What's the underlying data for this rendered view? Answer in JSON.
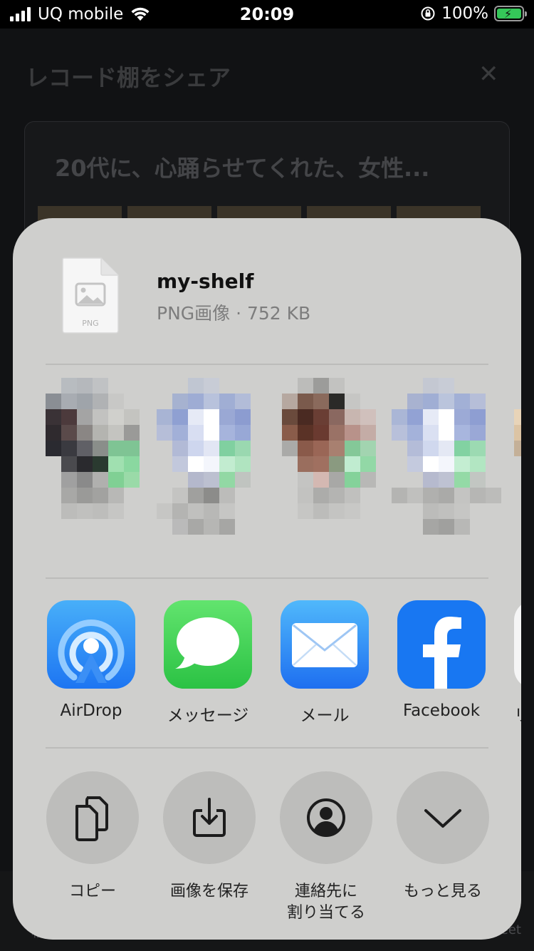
{
  "status_bar": {
    "carrier": "UQ mobile",
    "time": "20:09",
    "battery": "100%"
  },
  "background": {
    "title": "レコード棚をシェア",
    "card_title": "20代に、心踊らせてくれた、女性...",
    "footer_right": "weet",
    "footer_left": "杉"
  },
  "share": {
    "file_name": "my-shelf",
    "file_meta": "PNG画像 · 752 KB",
    "file_type": "PNG",
    "apps": [
      {
        "label": "AirDrop",
        "icon": "airdrop-icon"
      },
      {
        "label": "メッセージ",
        "icon": "messages-icon"
      },
      {
        "label": "メール",
        "icon": "mail-icon"
      },
      {
        "label": "Facebook",
        "icon": "facebook-icon"
      },
      {
        "label": "リ",
        "icon": "reminders-icon"
      }
    ],
    "actions": [
      {
        "label": "コピー",
        "icon": "copy-icon"
      },
      {
        "label": "画像を保存",
        "icon": "save-image-icon"
      },
      {
        "label": "連絡先に\n割り当てる",
        "icon": "assign-contact-icon"
      },
      {
        "label": "もっと見る",
        "icon": "chevron-down-icon"
      }
    ]
  },
  "colors": {
    "sheet": "#cfcfcd",
    "action_circle": "#bdbdbb",
    "accent_blue": "#1877f2",
    "battery_green": "#35c759"
  }
}
